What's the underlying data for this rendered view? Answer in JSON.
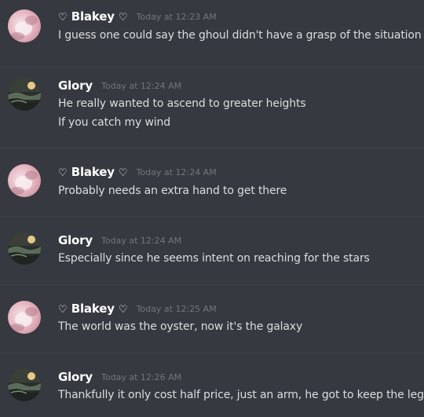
{
  "messages": [
    {
      "author": "Blakey",
      "heart_left": "♡",
      "heart_right": "♡",
      "avatar_icon": "pink-portrait-avatar",
      "timestamp": "Today at 12:23 AM",
      "lines": [
        "I guess one could say the ghoul didn't have a grasp of the situation"
      ]
    },
    {
      "author": "Glory",
      "heart_left": "",
      "heart_right": "",
      "avatar_icon": "night-landscape-moon-avatar",
      "timestamp": "Today at 12:24 AM",
      "lines": [
        "He really wanted to ascend to greater heights",
        "If you catch my wind"
      ]
    },
    {
      "author": "Blakey",
      "heart_left": "♡",
      "heart_right": "♡",
      "avatar_icon": "pink-portrait-avatar",
      "timestamp": "Today at 12:24 AM",
      "lines": [
        "Probably needs an extra hand to get there"
      ]
    },
    {
      "author": "Glory",
      "heart_left": "",
      "heart_right": "",
      "avatar_icon": "night-landscape-moon-avatar",
      "timestamp": "Today at 12:24 AM",
      "lines": [
        "Especially since he seems intent on reaching for the stars"
      ]
    },
    {
      "author": "Blakey",
      "heart_left": "♡",
      "heart_right": "♡",
      "avatar_icon": "pink-portrait-avatar",
      "timestamp": "Today at 12:25 AM",
      "lines": [
        "The world was the oyster, now it's the galaxy"
      ]
    },
    {
      "author": "Glory",
      "heart_left": "",
      "heart_right": "",
      "avatar_icon": "night-landscape-moon-avatar",
      "timestamp": "Today at 12:26 AM",
      "lines": [
        "Thankfully it only cost half price, just an arm, he got to keep the leg."
      ]
    }
  ],
  "colors": {
    "background": "#36393f",
    "username": "#ffffff",
    "timestamp": "#72767d",
    "message_text": "#dcddde",
    "divider": "#3f4248"
  }
}
